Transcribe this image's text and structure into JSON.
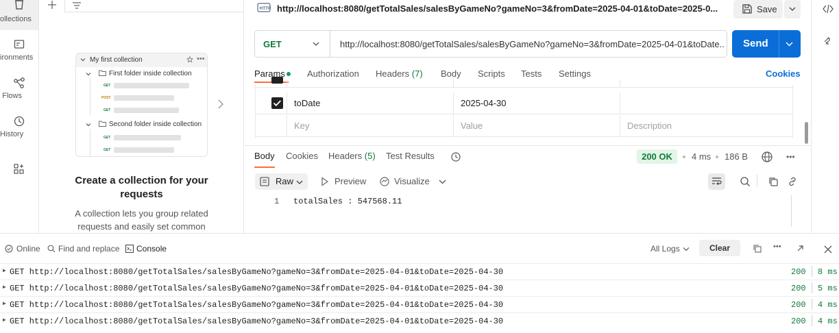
{
  "sidebar": {
    "items": [
      {
        "label": "ollections",
        "icon": "trash-collections-icon"
      },
      {
        "label": "ironments",
        "icon": "environment-icon"
      },
      {
        "label": "Flows",
        "icon": "flows-icon"
      },
      {
        "label": "History",
        "icon": "history-icon"
      },
      {
        "label": "",
        "icon": "apps-grid-icon"
      }
    ]
  },
  "collections": {
    "illustration": {
      "collection_name": "My first collection",
      "folder1": "First folder inside collection",
      "folder2": "Second folder inside collection",
      "methods": [
        "GET",
        "POST",
        "GET",
        "GET",
        "GET"
      ]
    },
    "empty_title": "Create a collection for your requests",
    "empty_sub_line1": "A collection lets you group related",
    "empty_sub_line2": "requests and easily set common"
  },
  "request": {
    "title_url": "http://localhost:8080/getTotalSales/salesByGameNo?gameNo=3&fromDate=2025-04-01&toDate=2025-0...",
    "save_label": "Save",
    "method": "GET",
    "url": "http://localhost:8080/getTotalSales/salesByGameNo?gameNo=3&fromDate=2025-04-01&toDate...",
    "send_label": "Send",
    "tabs": [
      "Params",
      "Authorization",
      "Headers",
      "Body",
      "Scripts",
      "Tests",
      "Settings"
    ],
    "headers_count": "(7)",
    "cookies_label": "Cookies",
    "params": {
      "row": {
        "key": "toDate",
        "value": "2025-04-30",
        "checked": true
      },
      "placeholder": {
        "key": "Key",
        "value": "Value",
        "description": "Description"
      }
    }
  },
  "response": {
    "tabs": [
      "Body",
      "Cookies",
      "Headers",
      "Test Results"
    ],
    "headers_count": "(5)",
    "status": "200 OK",
    "time": "4 ms",
    "size": "186 B",
    "view_modes": [
      "Raw",
      "Preview",
      "Visualize"
    ],
    "line_number": "1",
    "line_text": "totalSales : 547568.11"
  },
  "console": {
    "items": [
      "Online",
      "Find and replace",
      "Console"
    ],
    "filter": "All Logs",
    "clear_label": "Clear",
    "logs": [
      {
        "text": "GET http://localhost:8080/getTotalSales/salesByGameNo?gameNo=3&fromDate=2025-04-01&toDate=2025-04-30",
        "status": "200",
        "time": "8 ms"
      },
      {
        "text": "GET http://localhost:8080/getTotalSales/salesByGameNo?gameNo=3&fromDate=2025-04-01&toDate=2025-04-30",
        "status": "200",
        "time": "5 ms"
      },
      {
        "text": "GET http://localhost:8080/getTotalSales/salesByGameNo?gameNo=3&fromDate=2025-04-01&toDate=2025-04-30",
        "status": "200",
        "time": "4 ms"
      },
      {
        "text": "GET http://localhost:8080/getTotalSales/salesByGameNo?gameNo=3&fromDate=2025-04-01&toDate=2025-04-30",
        "status": "200",
        "time": "4 ms"
      }
    ]
  },
  "colors": {
    "accent": "#0b6ed8",
    "method_get": "#0f7a3a",
    "status_ok": "#0f7a3a",
    "tab_underline": "#ff6c37"
  }
}
